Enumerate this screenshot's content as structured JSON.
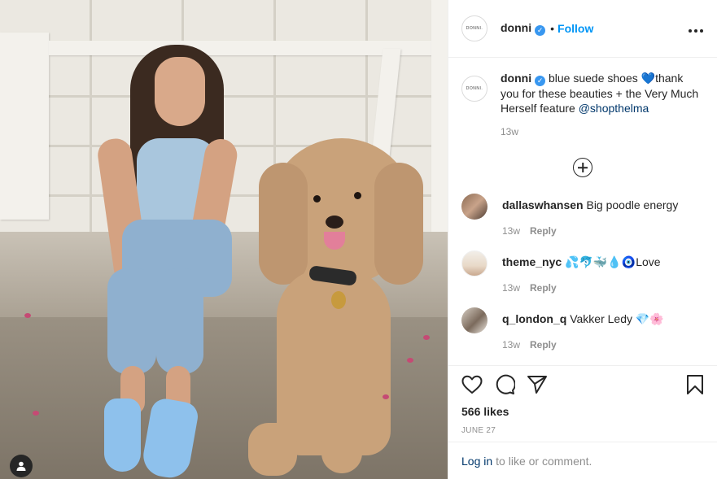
{
  "post": {
    "username": "donni",
    "avatar_logo": "DONNI.",
    "verified": true,
    "dot": "•",
    "follow_label": "Follow",
    "more_label": "•••"
  },
  "caption": {
    "username": "donni",
    "text_before_emoji": "blue suede shoes",
    "emoji": "💙",
    "text_after_emoji": "thank you for these beauties + the Very Much Herself feature",
    "mention": "@shopthelma",
    "time": "13w"
  },
  "comments": [
    {
      "username": "dallaswhansen",
      "text": "Big poodle energy",
      "time": "13w",
      "reply_label": "Reply"
    },
    {
      "username": "theme_nyc",
      "text": "💦🐬🐳💧🧿Love",
      "time": "13w",
      "reply_label": "Reply"
    },
    {
      "username": "q_london_q",
      "text": "Vakker Ledy 💎🌸",
      "time": "13w",
      "reply_label": "Reply"
    }
  ],
  "footer": {
    "likes": "566 likes",
    "date": "JUNE 27",
    "login_link": "Log in",
    "login_text": "to like or comment."
  },
  "colors": {
    "accent": "#0095f6",
    "verified": "#3897f0",
    "mention": "#00376b",
    "muted": "#8e8e8e"
  },
  "icons": [
    "user-tag-icon",
    "verified-badge-icon",
    "more-options-icon",
    "load-more-comments-icon",
    "heart-icon",
    "comment-icon",
    "share-icon",
    "bookmark-icon"
  ]
}
